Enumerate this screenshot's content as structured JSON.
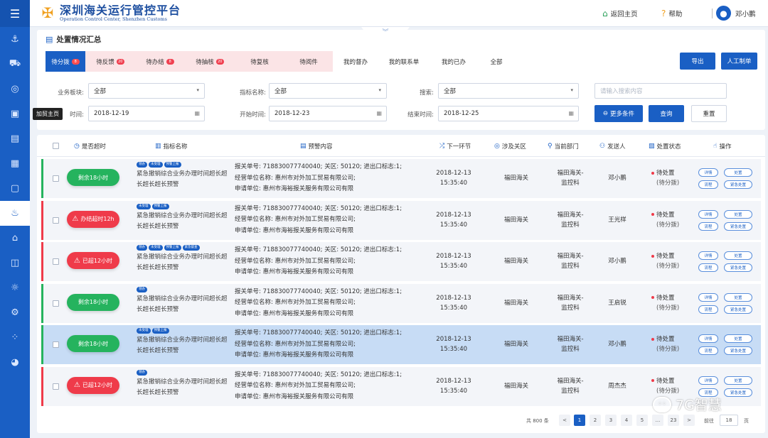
{
  "app": {
    "title_cn": "深圳海关运行管控平台",
    "title_en": "Operation Control Center, Shenzhen Customs",
    "home_label": "返回主页",
    "help_label": "帮助",
    "user_name": "邓小鹏"
  },
  "sidebar": {
    "tooltip": "加贸主页",
    "items": [
      {
        "icon": "menu-icon"
      },
      {
        "icon": "ship-icon"
      },
      {
        "icon": "truck-icon"
      },
      {
        "icon": "globe-icon"
      },
      {
        "icon": "box-icon"
      },
      {
        "icon": "chart-icon"
      },
      {
        "icon": "building-icon"
      },
      {
        "icon": "screen-icon"
      },
      {
        "icon": "alarm-icon"
      },
      {
        "icon": "warehouse-icon"
      },
      {
        "icon": "video-icon"
      },
      {
        "icon": "sun-icon"
      },
      {
        "icon": "settings-icon"
      },
      {
        "icon": "apps-icon"
      },
      {
        "icon": "pie-icon"
      }
    ]
  },
  "panel": {
    "title": "处置情况汇总",
    "tabs": [
      {
        "label": "待分拨",
        "badge": "8"
      },
      {
        "label": "待反馈",
        "badge": "20"
      },
      {
        "label": "待办结",
        "badge": "8"
      },
      {
        "label": "待抽核",
        "badge": "20"
      },
      {
        "label": "待复核",
        "badge": ""
      },
      {
        "label": "待阅件",
        "badge": ""
      },
      {
        "label": "我的督办",
        "badge": ""
      },
      {
        "label": "我的联系单",
        "badge": ""
      },
      {
        "label": "我的已办",
        "badge": ""
      },
      {
        "label": "全部",
        "badge": ""
      }
    ],
    "export_label": "导出",
    "manual_label": "人工制单"
  },
  "filters": {
    "business_label": "业务板块:",
    "business_value": "全部",
    "indicator_label": "指标名称:",
    "indicator_value": "全部",
    "search_label": "搜索:",
    "search_value": "全部",
    "keyword_placeholder": "请输入搜索内容",
    "time_label": "时间:",
    "time_value": "2018-12-19",
    "start_label": "开始时间:",
    "start_value": "2018-12-23",
    "end_label": "结束时间:",
    "end_value": "2018-12-25",
    "more_label": "更多条件",
    "query_label": "查询",
    "reset_label": "重置"
  },
  "table": {
    "headers": {
      "overtime": "是否超时",
      "indicator": "指标名称",
      "alert": "预警内容",
      "next_step": "下一环节",
      "area": "涉及关区",
      "dept": "当前部门",
      "sender": "发送人",
      "pstatus": "处置状态",
      "ops": "操作"
    },
    "ops_labels": [
      "详情",
      "处置",
      "流程",
      "紧急处置"
    ],
    "rows": [
      {
        "status": "剩余18小时",
        "tone": "green",
        "bar": "#25b35e",
        "selected": false,
        "tags": [
          "领办",
          "未受理",
          "预警上报"
        ],
        "indicator": "紧急撤销综合业务办理时间超长超长超长超长预警",
        "alert": [
          "报关单号: 718830077740040;  关区: 50120;  进出口标志:1;",
          "经营单位名称: 惠州市对外加工贸易有限公司;",
          "申请单位: 惠州市海裕报关服务有限公司有限"
        ],
        "next": [
          "2018-12-13",
          "15:35:40"
        ],
        "area": "福田海关",
        "dept": [
          "福田海关-",
          "监控科"
        ],
        "sender": "邓小鹏",
        "pstatus": "待处置",
        "pstatus_sub": "(待分拨)"
      },
      {
        "status": "办结超时12h",
        "tone": "red",
        "bar": "#ef3b4a",
        "selected": false,
        "tags": [
          "未受理",
          "预警上报"
        ],
        "indicator": "紧急撤销综合业务办理时间超长超长超长超长预警",
        "alert": [
          "报关单号: 718830077740040;  关区: 50120;  进出口标志:1;",
          "经营单位名称: 惠州市对外加工贸易有限公司;",
          "申请单位: 惠州市海裕报关服务有限公司有限"
        ],
        "next": [
          "2018-12-13",
          "15:35:40"
        ],
        "area": "福田海关",
        "dept": [
          "福田海关-",
          "监控科"
        ],
        "sender": "王光样",
        "pstatus": "待处置",
        "pstatus_sub": "(待分拨)"
      },
      {
        "status": "已超12小时",
        "tone": "red",
        "bar": "#ef3b4a",
        "selected": false,
        "tags": [
          "领办",
          "未受理",
          "预警上报",
          "紧急督查"
        ],
        "indicator": "紧急撤销综合业务办理时间超长超长超长超长预警",
        "alert": [
          "报关单号: 718830077740040;  关区: 50120;  进出口标志:1;",
          "经营单位名称: 惠州市对外加工贸易有限公司;",
          "申请单位: 惠州市海裕报关服务有限公司有限"
        ],
        "next": [
          "2018-12-13",
          "15:35:40"
        ],
        "area": "福田海关",
        "dept": [
          "福田海关-",
          "监控科"
        ],
        "sender": "邓小鹏",
        "pstatus": "待处置",
        "pstatus_sub": "(待分拨)"
      },
      {
        "status": "剩余18小时",
        "tone": "green",
        "bar": "#25b35e",
        "selected": false,
        "tags": [
          "领办"
        ],
        "indicator": "紧急撤销综合业务办理时间超长超长超长超长预警",
        "alert": [
          "报关单号: 718830077740040;  关区: 50120;  进出口标志:1;",
          "经营单位名称: 惠州市对外加工贸易有限公司;",
          "申请单位: 惠州市海裕报关服务有限公司有限"
        ],
        "next": [
          "2018-12-13",
          "15:35:40"
        ],
        "area": "福田海关",
        "dept": [
          "福田海关-",
          "监控科"
        ],
        "sender": "王启锐",
        "pstatus": "待处置",
        "pstatus_sub": "(待分拨)"
      },
      {
        "status": "剩余18小时",
        "tone": "green",
        "bar": "#25b35e",
        "selected": true,
        "tags": [
          "未受理",
          "预警上报"
        ],
        "indicator": "紧急撤销综合业务办理时间超长超长超长超长预警",
        "alert": [
          "报关单号: 718830077740040;  关区: 50120;  进出口标志:1;",
          "经营单位名称: 惠州市对外加工贸易有限公司;",
          "申请单位: 惠州市海裕报关服务有限公司有限"
        ],
        "next": [
          "2018-12-13",
          "15:35:40"
        ],
        "area": "福田海关",
        "dept": [
          "福田海关-",
          "监控科"
        ],
        "sender": "邓小鹏",
        "pstatus": "待处置",
        "pstatus_sub": "(待分拨)"
      },
      {
        "status": "已超12小时",
        "tone": "red",
        "bar": "#ef3b4a",
        "selected": false,
        "tags": [
          "领办"
        ],
        "indicator": "紧急撤销综合业务办理时间超长超长超长超长预警",
        "alert": [
          "报关单号: 718830077740040;  关区: 50120;  进出口标志:1;",
          "经营单位名称: 惠州市对外加工贸易有限公司;",
          "申请单位: 惠州市海裕报关服务有限公司有限"
        ],
        "next": [
          "2018-12-13",
          "15:35:40"
        ],
        "area": "福田海关",
        "dept": [
          "福田海关-",
          "监控科"
        ],
        "sender": "周杰杰",
        "pstatus": "待处置",
        "pstatus_sub": "(待分拨)"
      }
    ]
  },
  "pagination": {
    "total": "共 800 条",
    "prev": "<",
    "pages": [
      "1",
      "2",
      "3",
      "4",
      "5",
      "...",
      "23"
    ],
    "next": ">",
    "goto_label": "前往",
    "goto_value": "18",
    "page_unit": "页"
  },
  "watermark": {
    "text": "7G智慧"
  },
  "colors": {
    "primary": "#1a5fc4",
    "green": "#25b35e",
    "red": "#ef3b4a",
    "tab_shade": "#fbe4e6",
    "selected_row": "#c7dcf5"
  }
}
